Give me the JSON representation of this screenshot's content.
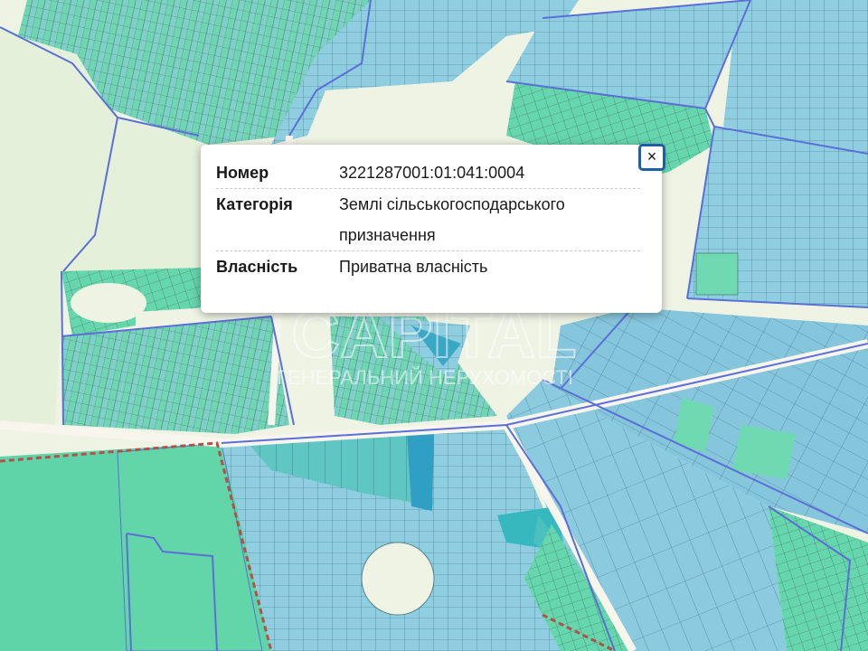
{
  "popup": {
    "close_label": "×",
    "rows": [
      {
        "key": "Номер",
        "value": "3221287001:01:041:0004"
      },
      {
        "key": "Категорія",
        "value": "Землі сільськогосподарського призначення"
      },
      {
        "key": "Власність",
        "value": "Приватна власність"
      }
    ]
  },
  "watermark": {
    "line1": "CAPITAL",
    "line2": "ГЕНЕРАЛЬНИЙ НЕРУХОМОСТІ"
  },
  "colors": {
    "parcel_blue": "#8fcde0",
    "parcel_green": "#5fd4a8",
    "boundary": "#5b6fd6",
    "road": "#f7f5ec",
    "background": "#eef3e4",
    "dashed_border": "#b2504a",
    "close_border": "#1e5fa8"
  }
}
